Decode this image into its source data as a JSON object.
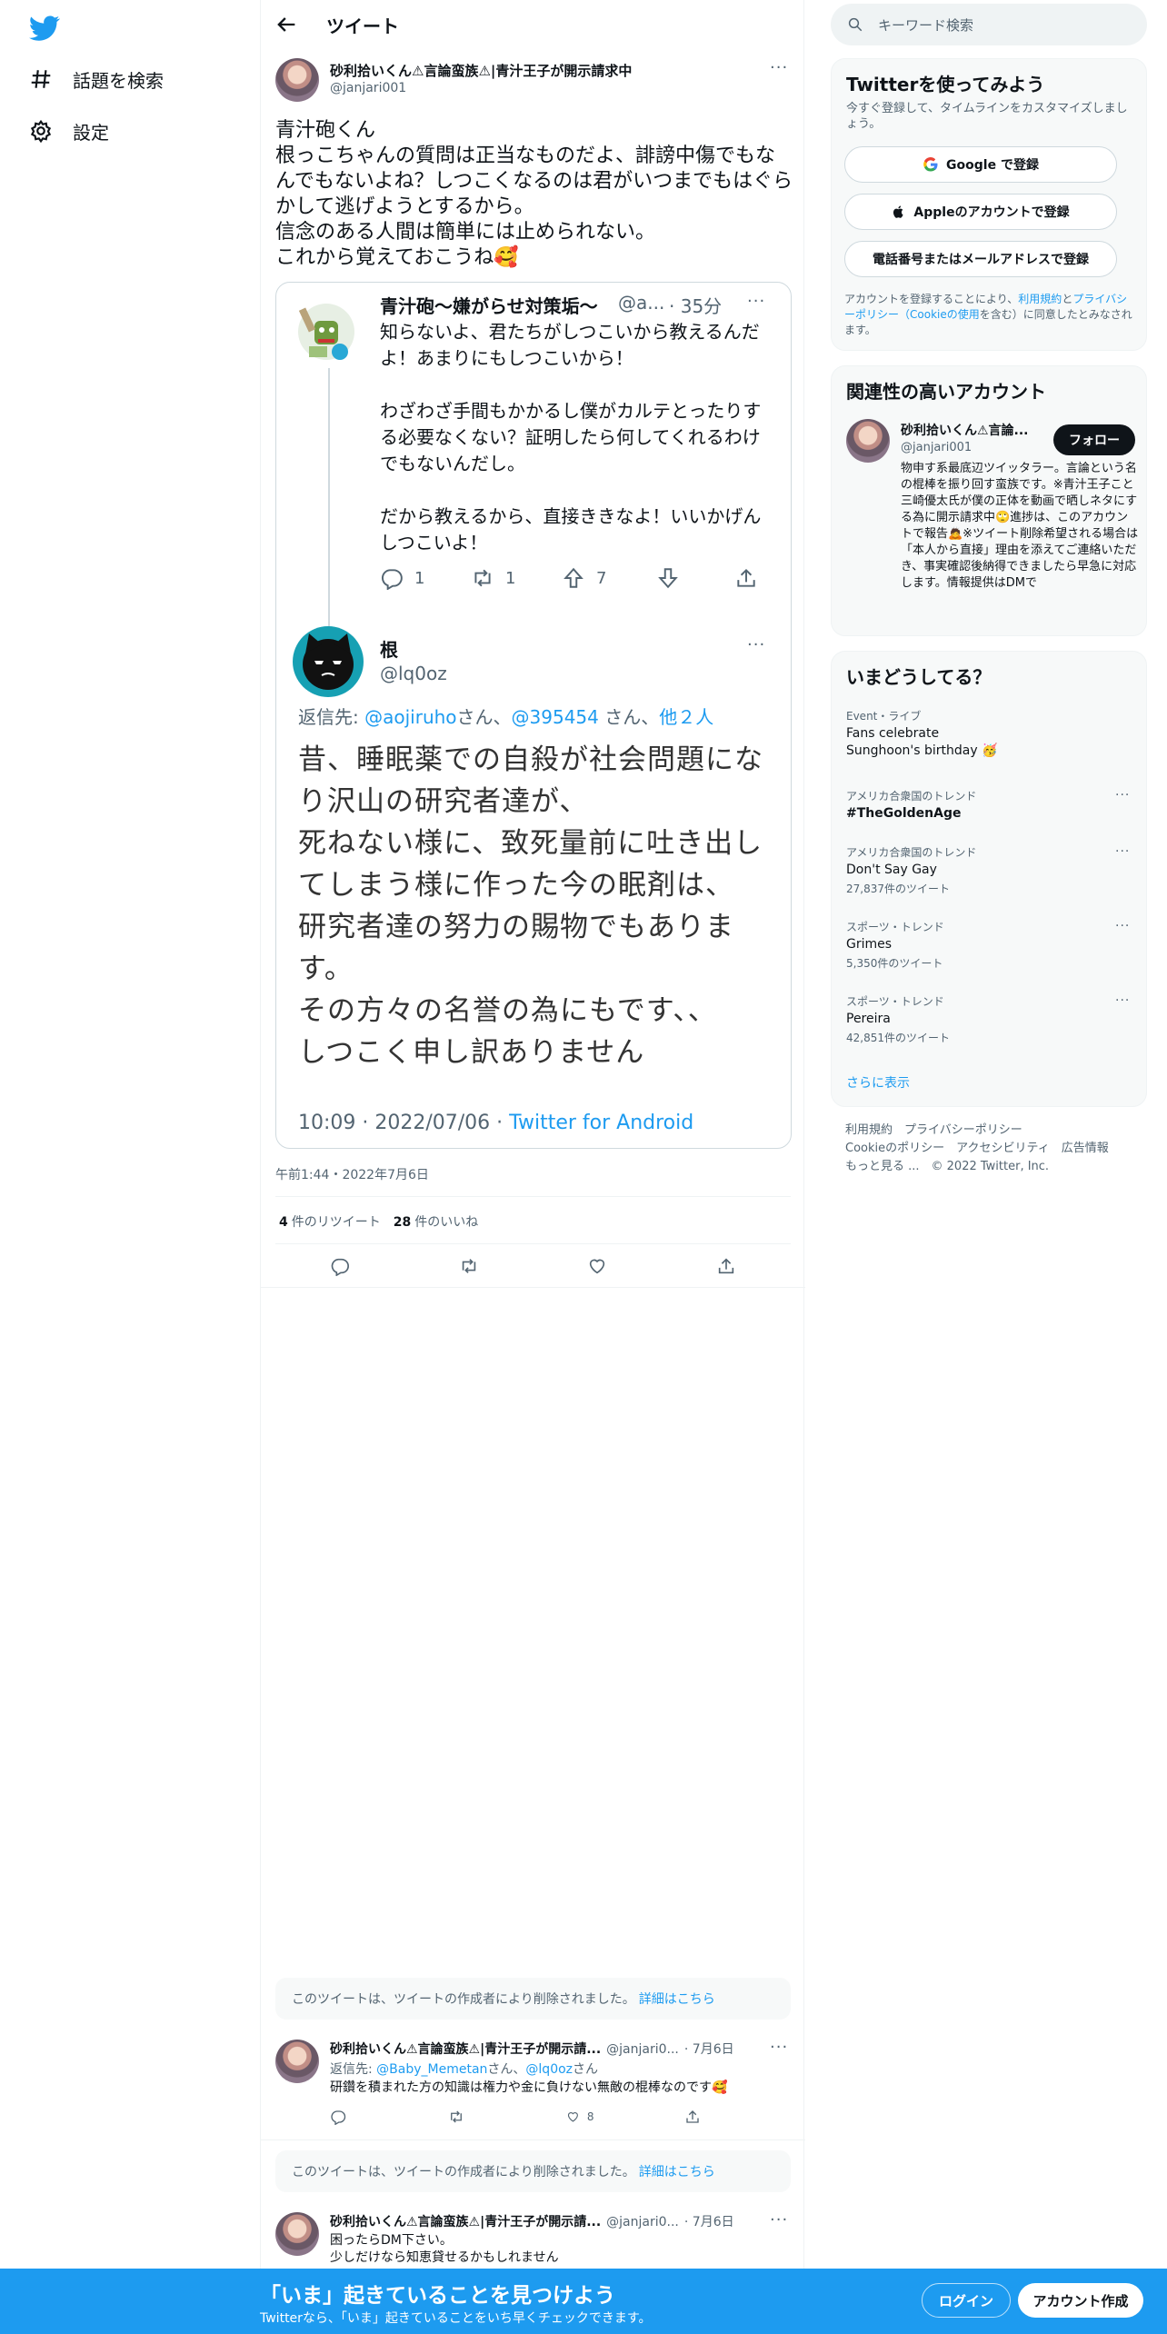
{
  "nav": {
    "explore_label": "話題を検索",
    "settings_label": "設定"
  },
  "header": {
    "title": "ツイート"
  },
  "tweet": {
    "author_name": "砂利拾いくん⚠言論蛮族⚠|青汁王子が開示請求中",
    "author_handle": "@janjari001",
    "text": "青汁砲くん\n根っこちゃんの質問は正当なものだよ、誹謗中傷でもなんでもないよね？しつこくなるのは君がいつまでもはぐらかして逃げようとするから。\n信念のある人間は簡単には止められない。\nこれから覚えておこうね🥰",
    "timestamp": "午前1:44・2022年7月6日",
    "retweets_count": "4",
    "retweets_label": "件のリツイート",
    "likes_count": "28",
    "likes_label": "件のいいね"
  },
  "quoted": {
    "parent": {
      "name": "青汁砲〜嫌がらせ対策垢〜",
      "handle": "@a...",
      "time": "· 35分",
      "text": "知らないよ、君たちがしつこいから教えるんだよ！あまりにもしつこいから！\n\nわざわざ手間もかかるし僕がカルテとったりする必要なくない？証明したら何してくれるわけでもないんだし。\n\nだから教えるから、直接ききなよ！いいかげんしつこいよ！",
      "replies": "1",
      "retweets": "1",
      "upvotes": "7"
    },
    "reply": {
      "name": "根",
      "handle": "@lq0oz",
      "reply_prefix": "返信先: ",
      "reply_mention1": "@aojiruho",
      "reply_san1": "さん、",
      "reply_mention2": "@395454",
      "reply_san2": " さん、",
      "reply_others": "他２人",
      "text": "昔、睡眠薬での自殺が社会問題になり沢山の研究者達が、\n死ねない様に、致死量前に吐き出してしまう様に作った今の眠剤は、\n研究者達の努力の賜物でもあります。\nその方々の名誉の為にもです、、\nしつこく申し訳ありません",
      "footer_time": "10:09 · 2022/07/06 · ",
      "footer_client": "Twitter for Android"
    }
  },
  "replies": [
    {
      "deleted_text": "このツイートは、ツイートの作成者により削除されました。",
      "deleted_link": "詳細はこちら",
      "name": "砂利拾いくん⚠言論蛮族⚠|青汁王子が開示請...",
      "handle": "@janjari0...",
      "date": "· 7月6日",
      "reply_prefix": "返信先: ",
      "mention1": "@Baby_Memetan",
      "mid": "さん、",
      "mention2": "@lq0oz",
      "suffix": "さん",
      "text": "研鑽を積まれた方の知識は権力や金に負けない無敵の棍棒なのです🥰",
      "likes": "8"
    },
    {
      "deleted_text": "このツイートは、ツイートの作成者により削除されました。",
      "deleted_link": "詳細はこちら",
      "name": "砂利拾いくん⚠言論蛮族⚠|青汁王子が開示請...",
      "handle": "@janjari0...",
      "date": "· 7月6日",
      "text": "困ったらDM下さい。\n少しだけなら知恵貸せるかもしれません"
    }
  ],
  "search": {
    "placeholder": "キーワード検索"
  },
  "signup_panel": {
    "title": "Twitterを使ってみよう",
    "subtitle": "今すぐ登録して、タイムラインをカスタマイズしましょう。",
    "google_label": "Google で登録",
    "apple_label": "Appleのアカウントで登録",
    "phone_label": "電話番号またはメールアドレスで登録",
    "terms_pre": "アカウントを登録することにより、",
    "terms_link1": "利用規約",
    "terms_and": "と",
    "terms_link2": "プライバシーポリシー（Cookieの使用",
    "terms_post": "を含む）に同意したとみなされます。"
  },
  "relevant": {
    "title": "関連性の高いアカウント",
    "name": "砂利拾いくん⚠言論...",
    "handle": "@janjari001",
    "follow_label": "フォロー",
    "bio": "物申す系最底辺ツイッタラー。言論という名の棍棒を振り回す蛮族です。※青汁王子こと三崎優太氏が僕の正体を動画で晒しネタにする為に開示請求中🙄進捗は、このアカウントで報告🙇※ツイート削除希望される場合は「本人から直接」理由を添えてご連絡いただき、事実確認後納得できましたら早急に対応します。情報提供はDMで"
  },
  "trends": {
    "title": "いまどうしてる？",
    "items": [
      {
        "category": "Event・ライブ",
        "name": "Fans celebrate Sunghoon's birthday 🥳",
        "count": ""
      },
      {
        "category": "アメリカ合衆国のトレンド",
        "name": "#TheGoldenAge",
        "count": ""
      },
      {
        "category": "アメリカ合衆国のトレンド",
        "name": "Don't Say Gay",
        "count": "27,837件のツイート"
      },
      {
        "category": "スポーツ・トレンド",
        "name": "Grimes",
        "count": "5,350件のツイート"
      },
      {
        "category": "スポーツ・トレンド",
        "name": "Pereira",
        "count": "42,851件のツイート"
      }
    ],
    "show_more": "さらに表示"
  },
  "footer": {
    "line1": "利用規約　プライバシーポリシー",
    "line2": "Cookieのポリシー　アクセシビリティ　広告情報",
    "line3": "もっと見る ...　© 2022 Twitter, Inc."
  },
  "banner": {
    "title": "「いま」起きていることを見つけよう",
    "subtitle": "Twitterなら、「いま」起きていることをいち早くチェックできます。",
    "login_label": "ログイン",
    "signup_label": "アカウント作成"
  },
  "colors": {
    "brand": "#1d9bf0",
    "text": "#0f1419",
    "muted": "#536471"
  }
}
